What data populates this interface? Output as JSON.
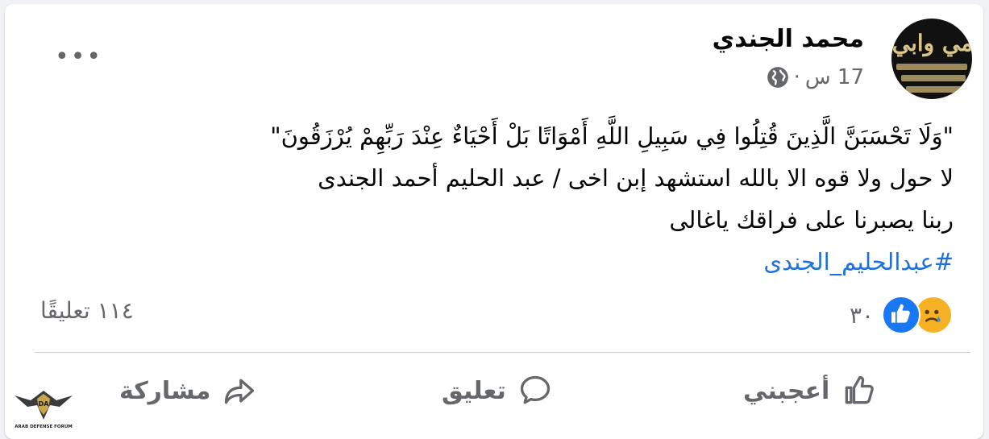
{
  "post": {
    "author": "محمد الجندي",
    "time": "17 س",
    "separator": "·",
    "text_lines": [
      "\"وَلَا تَحْسَبَنَّ الَّذِينَ قُتِلُوا فِي سَبِيلِ اللَّهِ أَمْوَاتًا بَلْ أَحْيَاءٌ عِنْدَ رَبِّهِمْ يُرْزَقُونَ\"",
      "لا حول ولا قوه الا بالله استشهد إبن اخى / عبد الحليم أحمد  الجندى",
      "ربنا يصبرنا على فراقك ياغالى"
    ],
    "hashtag": "#عبدالحليم_الجندى",
    "more_label": "•••"
  },
  "stats": {
    "reactions_count": "٣٠",
    "comments": "١١٤ تعليقًا"
  },
  "actions": {
    "like": "أعجبني",
    "comment": "تعليق",
    "share": "مشاركة"
  },
  "avatar": {
    "banner": "مي وابي"
  },
  "watermark": {
    "brand": "ARAB DEFENSE FORUM",
    "initials": "DA"
  },
  "colors": {
    "accent": "#216fdb",
    "like": "#1877f2",
    "sad": "#f7b125",
    "muted": "#65676b"
  }
}
